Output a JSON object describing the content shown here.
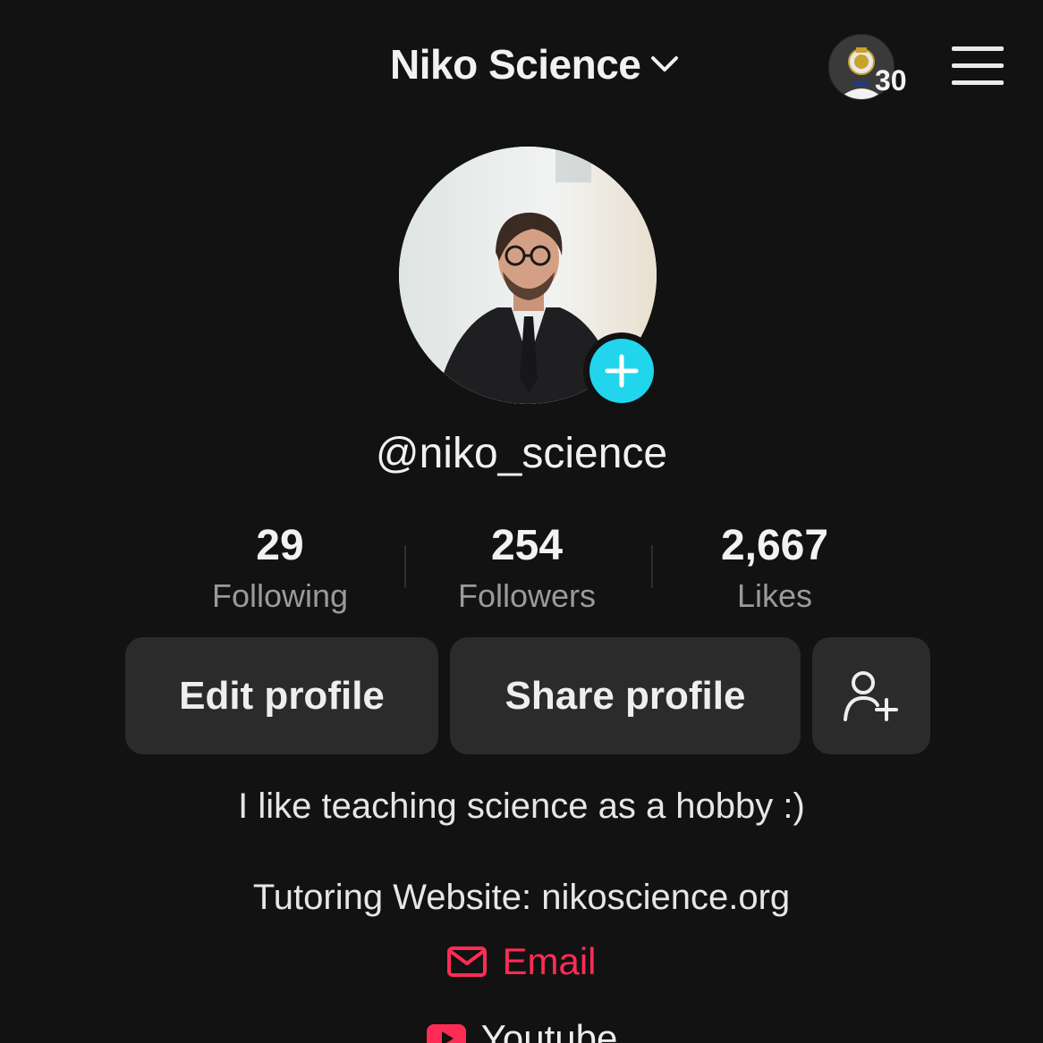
{
  "header": {
    "title": "Niko Science",
    "story_count": "30"
  },
  "profile": {
    "handle": "@niko_science",
    "stats": [
      {
        "value": "29",
        "label": "Following"
      },
      {
        "value": "254",
        "label": "Followers"
      },
      {
        "value": "2,667",
        "label": "Likes"
      }
    ],
    "actions": {
      "edit": "Edit profile",
      "share": "Share profile"
    },
    "bio": "I like teaching science as a hobby :)",
    "website_line": "Tutoring Website: nikoscience.org",
    "links": [
      {
        "label": "Email",
        "icon": "mail-icon",
        "color": "#fe2c55"
      },
      {
        "label": "Youtube",
        "icon": "youtube-icon",
        "color": "#fe2c55"
      }
    ]
  },
  "colors": {
    "background": "#121212",
    "accent_add": "#20d5ec",
    "link": "#fe2c55",
    "button_bg": "#2b2b2b"
  }
}
